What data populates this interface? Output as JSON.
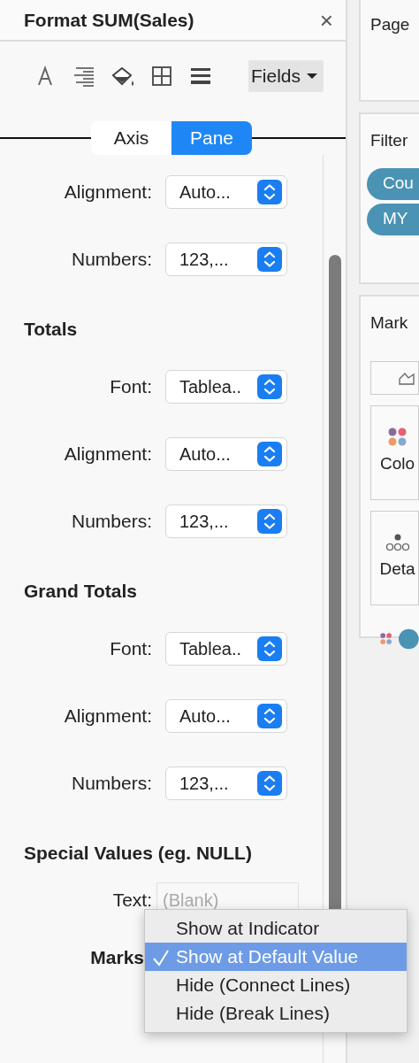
{
  "panel": {
    "title": "Format SUM(Sales)",
    "close": "×",
    "fields_button": "Fields"
  },
  "toolbar": [
    {
      "kind": "font"
    },
    {
      "kind": "align"
    },
    {
      "kind": "shading"
    },
    {
      "kind": "borders"
    },
    {
      "kind": "lines"
    }
  ],
  "tabs": [
    {
      "label": "Axis",
      "selected": false
    },
    {
      "label": "Pane",
      "selected": true
    }
  ],
  "sections": [
    {
      "rows": [
        {
          "label": "Alignment:",
          "value": "Auto..."
        },
        {
          "label": "Numbers:",
          "value": "123,..."
        }
      ]
    },
    {
      "heading": "Totals",
      "rows": [
        {
          "label": "Font:",
          "value": "Tablea.."
        },
        {
          "label": "Alignment:",
          "value": "Auto..."
        },
        {
          "label": "Numbers:",
          "value": "123,..."
        }
      ]
    },
    {
      "heading": "Grand Totals",
      "rows": [
        {
          "label": "Font:",
          "value": "Tablea.."
        },
        {
          "label": "Alignment:",
          "value": "Auto..."
        },
        {
          "label": "Numbers:",
          "value": "123,..."
        }
      ]
    }
  ],
  "special_values": {
    "heading": "Special Values (eg. NULL)",
    "text_label": "Text:",
    "text_placeholder": "(Blank)",
    "marks_label": "Marks"
  },
  "menu": [
    {
      "label": "Show at Indicator",
      "selected": false
    },
    {
      "label": "Show at Default Value",
      "selected": true
    },
    {
      "label": "Hide (Connect Lines)",
      "selected": false
    },
    {
      "label": "Hide (Break Lines)",
      "selected": false
    }
  ],
  "side": {
    "pages_title": "Page",
    "filters_title": "Filter",
    "filter_pills": [
      "Cou",
      "MY"
    ],
    "marks_title": "Mark",
    "mark_tiles": [
      {
        "kind": "color",
        "label": "Colo"
      },
      {
        "kind": "detail",
        "label": "Deta"
      }
    ]
  }
}
